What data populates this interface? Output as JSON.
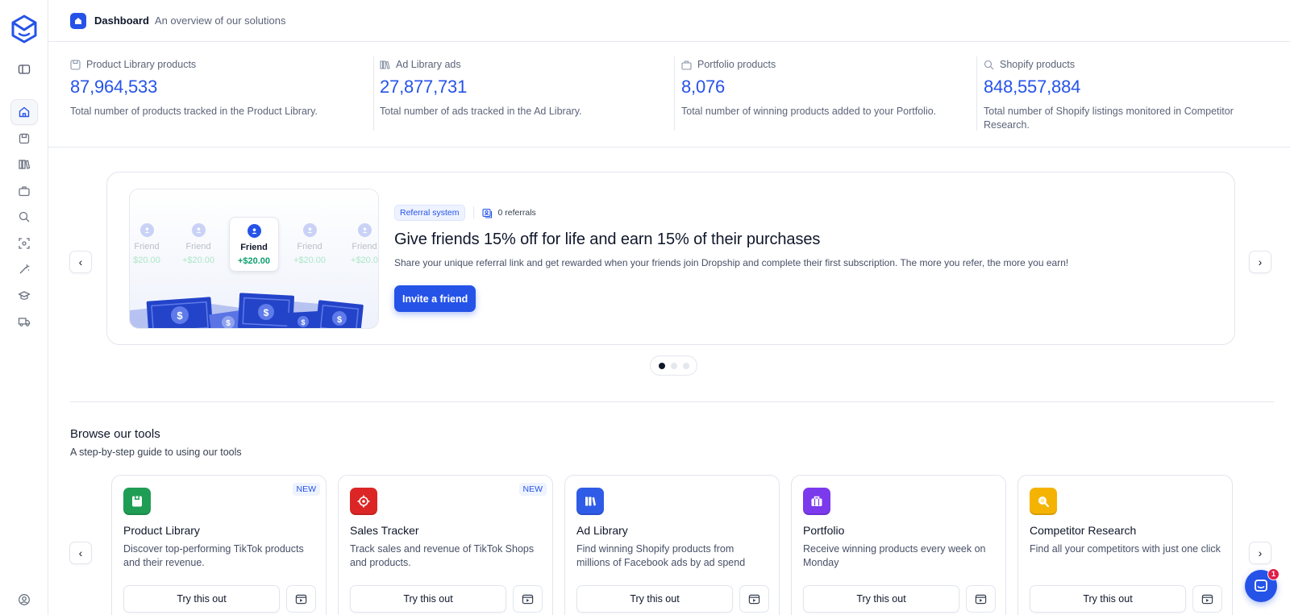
{
  "header": {
    "title": "Dashboard",
    "subtitle": "An overview of our solutions"
  },
  "sidebar": {
    "items": [
      {
        "icon": "layout-panel-icon"
      },
      {
        "icon": "home-icon",
        "active": true
      },
      {
        "icon": "product-library-icon"
      },
      {
        "icon": "ad-library-icon"
      },
      {
        "icon": "portfolio-icon"
      },
      {
        "icon": "search-icon"
      },
      {
        "icon": "scan-icon"
      },
      {
        "icon": "magic-wand-icon"
      },
      {
        "icon": "graduation-cap-icon"
      },
      {
        "icon": "truck-icon"
      },
      {
        "icon": "user-circle-icon"
      }
    ]
  },
  "stats": [
    {
      "label": "Product Library products",
      "value": "87,964,533",
      "desc": "Total number of products tracked in the Product Library."
    },
    {
      "label": "Ad Library ads",
      "value": "27,877,731",
      "desc": "Total number of ads tracked in the Ad Library."
    },
    {
      "label": "Portfolio products",
      "value": "8,076",
      "desc": "Total number of winning products added to your Portfolio."
    },
    {
      "label": "Shopify products",
      "value": "848,557,884",
      "desc": "Total number of Shopify listings monitored in Competitor Research."
    }
  ],
  "promo": {
    "tag": "Referral system",
    "referrals": "0 referrals",
    "title": "Give friends 15% off for life and earn 15% of their purchases",
    "description": "Share your unique referral link and get rewarded when your friends join Dropship and complete their first subscription. The more you refer, the more you earn!",
    "cta": "Invite a friend",
    "friends": [
      {
        "name": "Friend",
        "amount": "$20.00"
      },
      {
        "name": "Friend",
        "amount": "+$20.00"
      },
      {
        "name": "Friend",
        "amount": "+$20.00"
      },
      {
        "name": "Friend",
        "amount": "+$20.00"
      },
      {
        "name": "Friend",
        "amount": "+$20.0"
      }
    ],
    "slide_count": 3,
    "active_slide": 1
  },
  "tools": {
    "title": "Browse our tools",
    "subtitle": "A step-by-step guide to using our tools",
    "cards": [
      {
        "title": "Product Library",
        "desc": "Discover top-performing TikTok products and their revenue.",
        "badge": "NEW",
        "cta": "Try this out",
        "color": "#1f9d55"
      },
      {
        "title": "Sales Tracker",
        "desc": "Track sales and revenue of TikTok Shops and products.",
        "badge": "NEW",
        "cta": "Try this out",
        "color": "#dc2626"
      },
      {
        "title": "Ad Library",
        "desc": "Find winning Shopify products from millions of Facebook ads by ad spend",
        "badge": "",
        "cta": "Try this out",
        "color": "#2f5ce6"
      },
      {
        "title": "Portfolio",
        "desc": "Receive winning products every week on Monday",
        "badge": "",
        "cta": "Try this out",
        "color": "#7c3aed"
      },
      {
        "title": "Competitor Research",
        "desc": "Find all your competitors with just one click",
        "badge": "",
        "cta": "Try this out",
        "color": "#f5b301"
      }
    ]
  },
  "chat": {
    "badge": "1"
  },
  "colors": {
    "accent": "#2553e8",
    "text": "#0f172a",
    "muted": "#5b6478",
    "border": "#e5e8ef",
    "success": "#0e9f6e"
  }
}
